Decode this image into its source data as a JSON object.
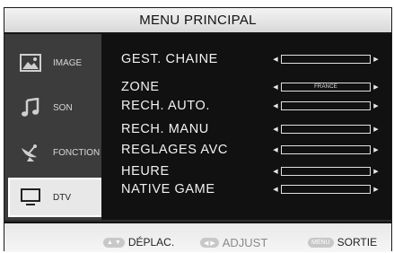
{
  "menu": {
    "title": "MENU PRINCIPAL"
  },
  "sidebar": {
    "items": [
      {
        "label": "IMAGE",
        "icon": "picture-icon",
        "active": false
      },
      {
        "label": "SON",
        "icon": "music-note-icon",
        "active": false
      },
      {
        "label": "FONCTION",
        "icon": "satellite-dish-icon",
        "active": false
      },
      {
        "label": "DTV",
        "icon": "monitor-icon",
        "active": true
      }
    ]
  },
  "settings": {
    "rows": [
      {
        "label": "GEST. CHAINE",
        "value": ""
      },
      {
        "label": "ZONE",
        "value": "FRANCE"
      },
      {
        "label": "RECH. AUTO.",
        "value": ""
      },
      {
        "label": "RECH. MANU",
        "value": ""
      },
      {
        "label": "REGLAGES AVC",
        "value": ""
      },
      {
        "label": "HEURE",
        "value": ""
      },
      {
        "label": "NATIVE GAME",
        "value": ""
      }
    ]
  },
  "footer": {
    "move": {
      "key": "▲ ▼",
      "label": "DÉPLAC."
    },
    "adjust": {
      "key": "◀ ▶",
      "label": "ADJUST"
    },
    "exit": {
      "key": "MENU",
      "label": "SORTIE"
    }
  },
  "colors": {
    "background": "#2e2e2e",
    "content": "#111111",
    "text": "#f2f2f2",
    "active_tab": "#e8e8e8"
  }
}
